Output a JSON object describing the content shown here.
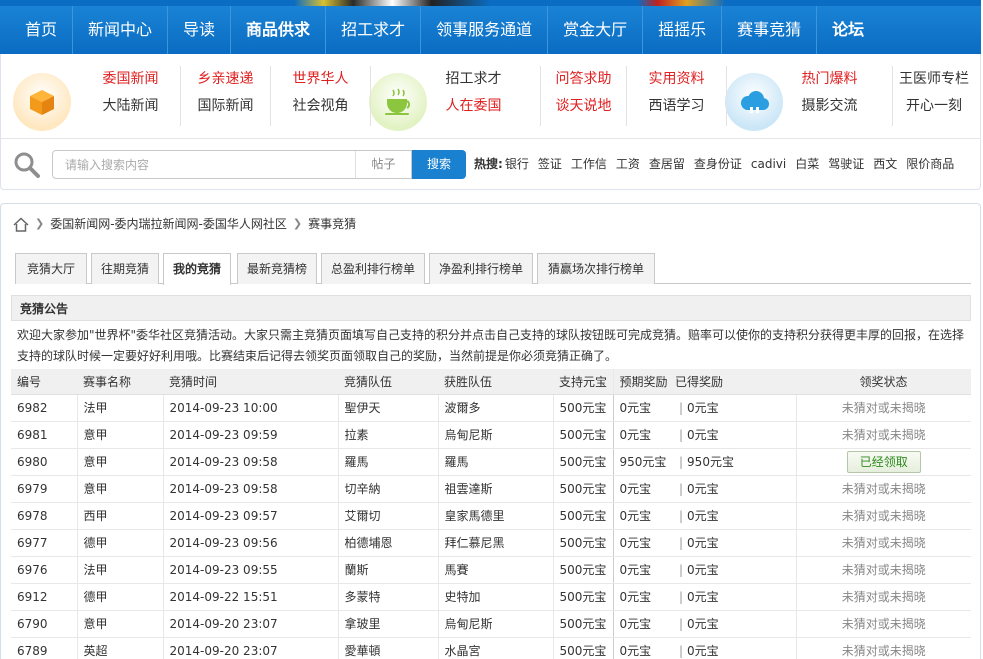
{
  "nav": {
    "items": [
      {
        "label": "首页",
        "bold": false
      },
      {
        "label": "新闻中心",
        "bold": false
      },
      {
        "label": "导读",
        "bold": false
      },
      {
        "label": "商品供求",
        "bold": true
      },
      {
        "label": "招工求才",
        "bold": false
      },
      {
        "label": "领事服务通道",
        "bold": false
      },
      {
        "label": "赏金大厅",
        "bold": false
      },
      {
        "label": "摇摇乐",
        "bold": false
      },
      {
        "label": "赛事竞猜",
        "bold": false
      },
      {
        "label": "论坛",
        "bold": true
      }
    ]
  },
  "channels": {
    "groups": [
      {
        "top": "委国新闻",
        "top_color": "red",
        "bottom": "大陆新闻",
        "bottom_color": "dark"
      },
      {
        "top": "乡亲速递",
        "top_color": "red",
        "bottom": "国际新闻",
        "bottom_color": "dark"
      },
      {
        "top": "世界华人",
        "top_color": "red",
        "bottom": "社会视角",
        "bottom_color": "dark"
      },
      {
        "top": "招工求才",
        "top_color": "dark",
        "bottom": "人在委国",
        "bottom_color": "red"
      },
      {
        "top": "问答求助",
        "top_color": "red",
        "bottom": "谈天说地",
        "bottom_color": "red"
      },
      {
        "top": "实用资料",
        "top_color": "red",
        "bottom": "西语学习",
        "bottom_color": "dark"
      },
      {
        "top": "热门爆料",
        "top_color": "red",
        "bottom": "摄影交流",
        "bottom_color": "dark"
      },
      {
        "top": "王医师专栏",
        "top_color": "dark",
        "bottom": "开心一刻",
        "bottom_color": "dark"
      }
    ]
  },
  "search": {
    "placeholder": "请输入搜索内容",
    "scope": "帖子",
    "button": "搜索",
    "hot_label": "热搜:",
    "hot_items": [
      "银行",
      "签证",
      "工作信",
      "工资",
      "查居留",
      "查身份证",
      "cadivi",
      "白菜",
      "驾驶证",
      "西文",
      "限价商品"
    ]
  },
  "breadcrumb": {
    "site": "委国新闻网-委内瑞拉新闻网-委国华人网社区",
    "current": "赛事竞猜"
  },
  "tabs": [
    {
      "label": "竞猜大厅",
      "active": false
    },
    {
      "label": "往期竞猜",
      "active": false
    },
    {
      "label": "我的竞猜",
      "active": true
    },
    {
      "label": "最新竞猜榜",
      "active": false
    },
    {
      "label": "总盈利排行榜单",
      "active": false
    },
    {
      "label": "净盈利排行榜单",
      "active": false
    },
    {
      "label": "猜赢场次排行榜单",
      "active": false
    }
  ],
  "announcement": {
    "title": "竞猜公告",
    "text": "欢迎大家参加\"世界杯\"委华社区竞猜活动。大家只需主竞猜页面填写自己支持的积分并点击自己支持的球队按钮既可完成竞猜。赔率可以使你的支持积分获得更丰厚的回报，在选择支持的球队时候一定要好好利用哦。比赛结束后记得去领奖页面领取自己的奖励，当然前提是你必须竞猜正确了。"
  },
  "table": {
    "headers": {
      "id": "编号",
      "event": "赛事名称",
      "time": "竞猜时间",
      "team": "竞猜队伍",
      "winner": "获胜队伍",
      "stake": "支持元宝",
      "expected": "预期奖励",
      "won": "已得奖励",
      "status": "领奖状态"
    },
    "rows": [
      {
        "id": "6982",
        "event": "法甲",
        "time": "2014-09-23 10:00",
        "team": "聖伊天",
        "winner": "波爾多",
        "stake": "500元宝",
        "expected": "0元宝",
        "won": "0元宝",
        "status": "未猜对或未揭晓",
        "claimed": false
      },
      {
        "id": "6981",
        "event": "意甲",
        "time": "2014-09-23 09:59",
        "team": "拉素",
        "winner": "烏甸尼斯",
        "stake": "500元宝",
        "expected": "0元宝",
        "won": "0元宝",
        "status": "未猜对或未揭晓",
        "claimed": false
      },
      {
        "id": "6980",
        "event": "意甲",
        "time": "2014-09-23 09:58",
        "team": "羅馬",
        "winner": "羅馬",
        "stake": "500元宝",
        "expected": "950元宝",
        "won": "950元宝",
        "status": "已经领取",
        "claimed": true
      },
      {
        "id": "6979",
        "event": "意甲",
        "time": "2014-09-23 09:58",
        "team": "切辛納",
        "winner": "祖雲達斯",
        "stake": "500元宝",
        "expected": "0元宝",
        "won": "0元宝",
        "status": "未猜对或未揭晓",
        "claimed": false
      },
      {
        "id": "6978",
        "event": "西甲",
        "time": "2014-09-23 09:57",
        "team": "艾爾切",
        "winner": "皇家馬德里",
        "stake": "500元宝",
        "expected": "0元宝",
        "won": "0元宝",
        "status": "未猜对或未揭晓",
        "claimed": false
      },
      {
        "id": "6977",
        "event": "德甲",
        "time": "2014-09-23 09:56",
        "team": "柏德埔恩",
        "winner": "拜仁慕尼黑",
        "stake": "500元宝",
        "expected": "0元宝",
        "won": "0元宝",
        "status": "未猜对或未揭晓",
        "claimed": false
      },
      {
        "id": "6976",
        "event": "法甲",
        "time": "2014-09-23 09:55",
        "team": "蘭斯",
        "winner": "馬賽",
        "stake": "500元宝",
        "expected": "0元宝",
        "won": "0元宝",
        "status": "未猜对或未揭晓",
        "claimed": false
      },
      {
        "id": "6912",
        "event": "德甲",
        "time": "2014-09-22 15:51",
        "team": "多蒙特",
        "winner": "史特加",
        "stake": "500元宝",
        "expected": "0元宝",
        "won": "0元宝",
        "status": "未猜对或未揭晓",
        "claimed": false
      },
      {
        "id": "6790",
        "event": "意甲",
        "time": "2014-09-20 23:07",
        "team": "拿玻里",
        "winner": "烏甸尼斯",
        "stake": "500元宝",
        "expected": "0元宝",
        "won": "0元宝",
        "status": "未猜对或未揭晓",
        "claimed": false
      },
      {
        "id": "6789",
        "event": "英超",
        "time": "2014-09-20 23:07",
        "team": "愛華頓",
        "winner": "水晶宮",
        "stake": "500元宝",
        "expected": "0元宝",
        "won": "0元宝",
        "status": "未猜对或未揭晓",
        "claimed": false
      }
    ]
  },
  "colors": {
    "nav_blue": "#0a6cc2",
    "link_red": "#e02020",
    "button_blue": "#1a80d0",
    "claimed_green": "#2f8a1e"
  },
  "icons": {
    "channel_1": "box-icon",
    "channel_2": "tea-cup-icon",
    "channel_3": "cloud-icon",
    "search": "magnifier-icon",
    "home": "home-icon"
  }
}
